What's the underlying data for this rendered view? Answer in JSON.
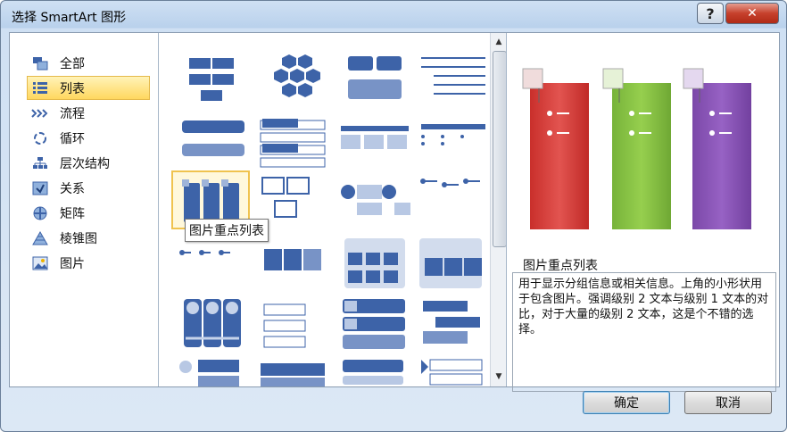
{
  "window": {
    "title": "选择 SmartArt 图形",
    "help_label": "?",
    "close_label": "✕"
  },
  "categories": [
    {
      "label": "全部",
      "icon": "all-icon"
    },
    {
      "label": "列表",
      "icon": "list-icon",
      "selected": true
    },
    {
      "label": "流程",
      "icon": "process-icon"
    },
    {
      "label": "循环",
      "icon": "cycle-icon"
    },
    {
      "label": "层次结构",
      "icon": "hierarchy-icon"
    },
    {
      "label": "关系",
      "icon": "relationship-icon"
    },
    {
      "label": "矩阵",
      "icon": "matrix-icon"
    },
    {
      "label": "棱锥图",
      "icon": "pyramid-icon"
    },
    {
      "label": "图片",
      "icon": "picture-icon"
    }
  ],
  "gallery": {
    "tooltip": "图片重点列表"
  },
  "preview": {
    "title": "图片重点列表",
    "description": "用于显示分组信息或相关信息。上角的小形状用于包含图片。强调级别 2 文本与级别 1 文本的对比，对于大量的级别 2 文本，这是个不错的选择。"
  },
  "buttons": {
    "ok": "确定",
    "cancel": "取消"
  },
  "colors": {
    "accent_blue": "#3d63a8",
    "red": "#d8403c",
    "green": "#8cc63f",
    "purple": "#8a55b5",
    "selection": "#ffd75e"
  }
}
